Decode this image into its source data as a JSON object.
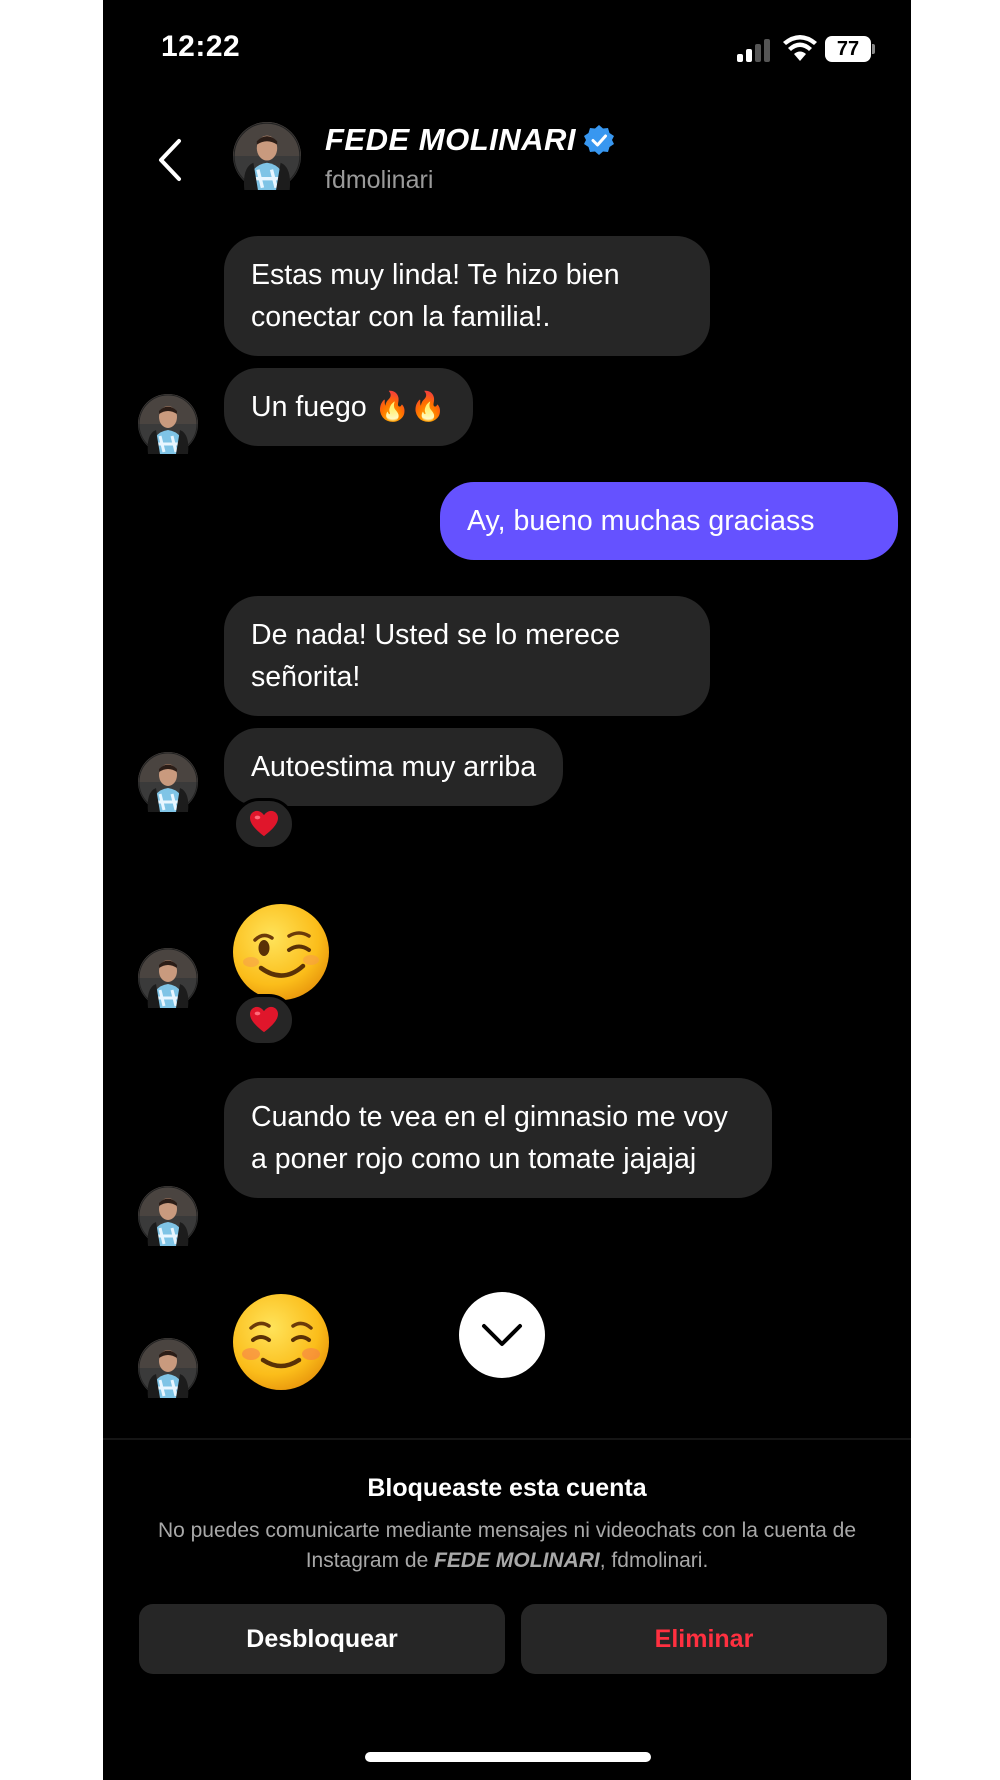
{
  "status_bar": {
    "time": "12:22",
    "battery": "77"
  },
  "header": {
    "name": "FEDE MOLINARI",
    "handle": "fdmolinari",
    "verified": true,
    "back_icon": "chevron-left-icon"
  },
  "messages": [
    {
      "from": "them",
      "text": "Estas muy linda! Te hizo bien conectar con la familia!."
    },
    {
      "from": "them",
      "text": "Un fuego 🔥🔥"
    },
    {
      "from": "me",
      "text": "Ay, bueno muchas graciass"
    },
    {
      "from": "them",
      "text": "De nada! Usted se lo merece señorita!"
    },
    {
      "from": "them",
      "text": "Autoestima muy arriba",
      "reaction": "heart"
    },
    {
      "from": "them",
      "emoji": "winking-face",
      "reaction": "heart"
    },
    {
      "from": "them",
      "text": "Cuando te vea en el gimnasio me voy a poner rojo como un tomate jajajaj"
    },
    {
      "from": "them",
      "emoji": "smiling-face"
    }
  ],
  "blocked": {
    "title": "Bloqueaste esta cuenta",
    "desc_prefix": "No puedes comunicarte mediante mensajes ni videochats con la cuenta de Instagram de ",
    "desc_name": "FEDE MOLINARI",
    "desc_suffix": ", fdmolinari.",
    "unblock_label": "Desbloquear",
    "delete_label": "Eliminar"
  },
  "colors": {
    "background": "#000000",
    "their_bubble": "#262626",
    "my_bubble": "#6552ff",
    "delete_red": "#ff3040",
    "verified_blue": "#3897f0"
  }
}
